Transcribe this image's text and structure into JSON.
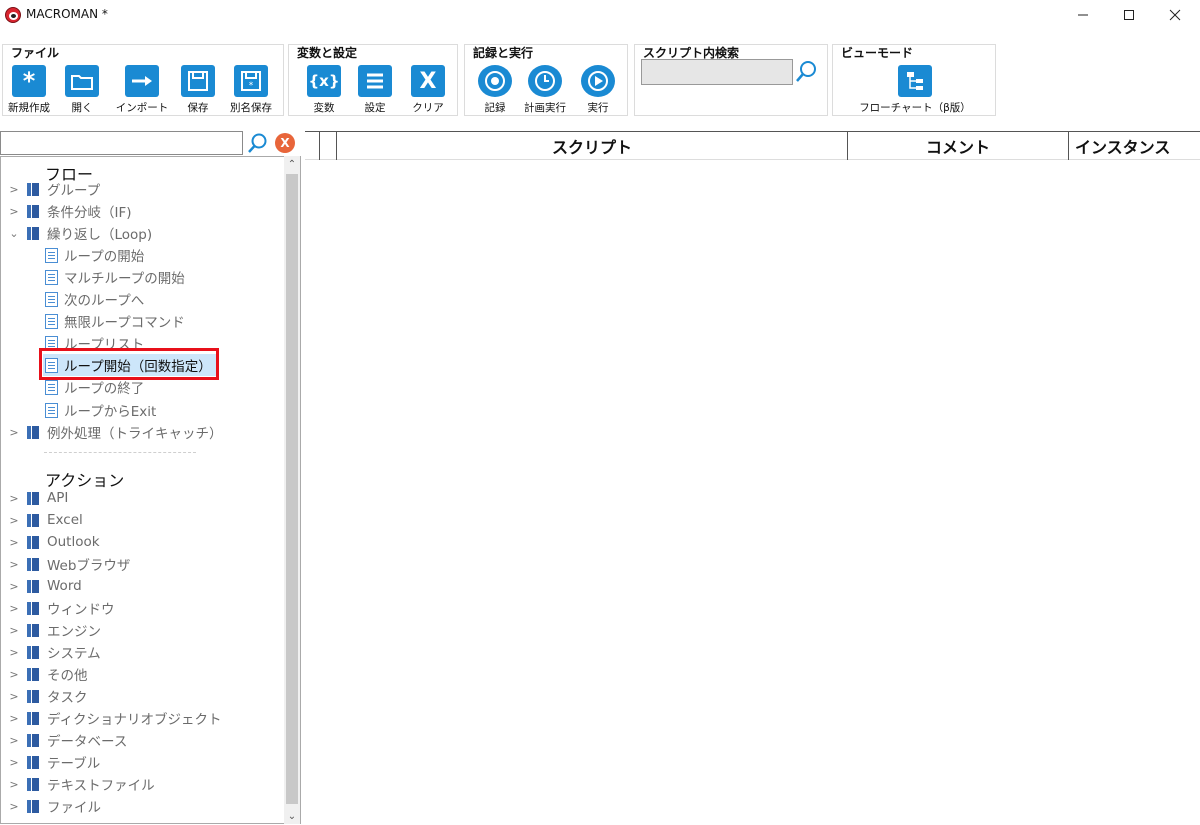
{
  "window": {
    "title": "MACROMAN *"
  },
  "ribbon": {
    "file": {
      "label": "ファイル",
      "buttons": [
        {
          "label": "新規作成",
          "icon": "asterisk-icon"
        },
        {
          "label": "開く",
          "icon": "folder-icon"
        },
        {
          "label": "インポート",
          "icon": "arrow-right-icon"
        },
        {
          "label": "保存",
          "icon": "save-icon"
        },
        {
          "label": "別名保存",
          "icon": "save-as-icon"
        }
      ]
    },
    "vars": {
      "label": "変数と設定",
      "buttons": [
        {
          "label": "変数",
          "icon_text": "{x}"
        },
        {
          "label": "設定",
          "icon": "list-icon"
        },
        {
          "label": "クリア",
          "icon_text": "X"
        }
      ]
    },
    "record": {
      "label": "記録と実行",
      "buttons": [
        {
          "label": "記録",
          "icon": "record-icon"
        },
        {
          "label": "計画実行",
          "icon": "schedule-icon"
        },
        {
          "label": "実行",
          "icon": "play-icon"
        }
      ]
    },
    "search": {
      "label": "スクリプト内検索",
      "value": ""
    },
    "view": {
      "label": "ビューモード",
      "buttons": [
        {
          "label": "フローチャート（β版）",
          "icon": "flowchart-icon"
        }
      ]
    }
  },
  "tree": {
    "search_value": "",
    "flow_label": "フロー",
    "flow_items": [
      {
        "label": "グループ",
        "expanded": false
      },
      {
        "label": "条件分岐（IF)",
        "expanded": false
      },
      {
        "label": "繰り返し（Loop)",
        "expanded": true
      }
    ],
    "loop_children": [
      "ループの開始",
      "マルチループの開始",
      "次のループへ",
      "無限ループコマンド",
      "ループリスト",
      "ループ開始（回数指定）",
      "ループの終了",
      "ループからExit"
    ],
    "selected_child": "ループ開始（回数指定）",
    "exception_item": "例外処理（トライキャッチ）",
    "action_label": "アクション",
    "action_items": [
      "API",
      "Excel",
      "Outlook",
      "Webブラウザ",
      "Word",
      "ウィンドウ",
      "エンジン",
      "システム",
      "その他",
      "タスク",
      "ディクショナリオブジェクト",
      "データベース",
      "テーブル",
      "テキストファイル",
      "ファイル"
    ]
  },
  "grid": {
    "columns": [
      "スクリプト",
      "コメント",
      "インスタンス"
    ]
  },
  "colors": {
    "accent": "#1a8ad3",
    "highlight": "#e8101a",
    "selected_bg": "#cde6fa",
    "clear_button": "#e8653a"
  }
}
